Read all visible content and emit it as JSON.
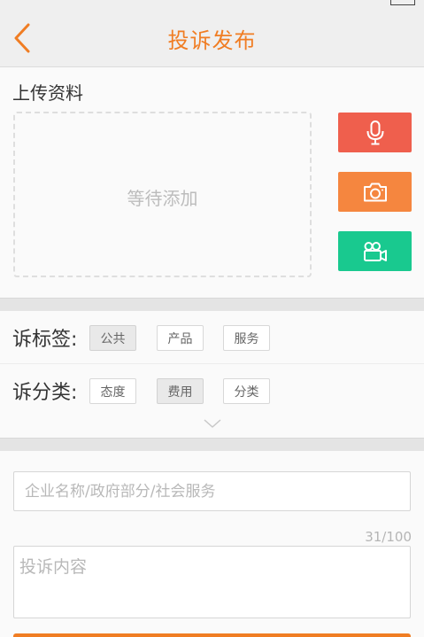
{
  "status_bar": {
    "carrier": "",
    "time": "",
    "battery": ""
  },
  "header": {
    "title": "投诉发布",
    "back_icon": "chevron-left-icon",
    "accent": "#f07d23"
  },
  "upload": {
    "label": "上传资料",
    "placeholder": "等待添加",
    "buttons": [
      {
        "icon": "microphone-icon",
        "color": "#ef5f4d"
      },
      {
        "icon": "camera-icon",
        "color": "#f5863f"
      },
      {
        "icon": "video-camera-icon",
        "color": "#19c98f"
      }
    ]
  },
  "tags": {
    "label": "诉标签:",
    "options": [
      "公共",
      "产品",
      "服务"
    ],
    "selected": "公共"
  },
  "categories": {
    "label": "诉分类:",
    "options": [
      "态度",
      "费用",
      "分类"
    ],
    "selected": "费用"
  },
  "expand_icon": "chevron-down-icon",
  "form": {
    "company_placeholder": "企业名称/政府部分/社会服务",
    "company_value": "",
    "counter": "31/100",
    "content_placeholder": "投诉内容",
    "content_value": ""
  }
}
